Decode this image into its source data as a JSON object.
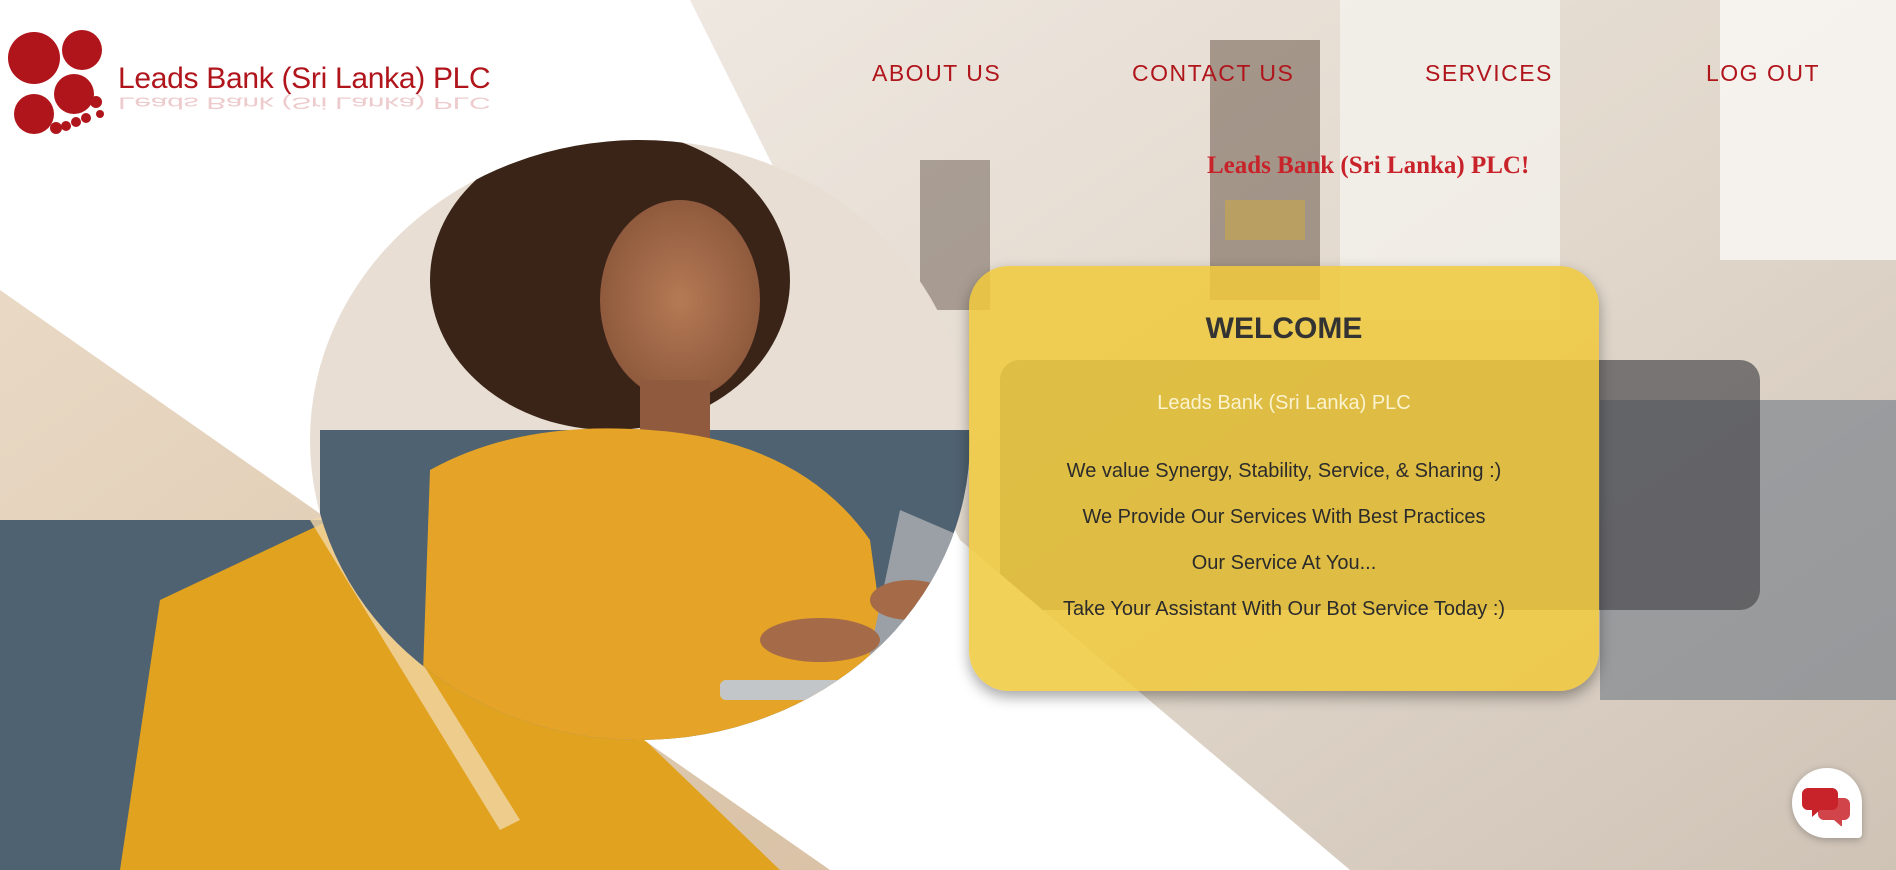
{
  "brand": {
    "name": "Leads Bank (Sri Lanka) PLC",
    "logo_icon": "red-circles-logo-icon",
    "color": "#b0151c"
  },
  "nav": {
    "items": [
      {
        "label": "ABOUT US"
      },
      {
        "label": "CONTACT US"
      },
      {
        "label": "SERVICES"
      },
      {
        "label": "LOG OUT"
      }
    ]
  },
  "greeting": "Leads Bank (Sri Lanka) PLC!",
  "welcome": {
    "title": "WELCOME",
    "subtitle": "Leads Bank (Sri Lanka) PLC",
    "lines": [
      "We value Synergy, Stability, Service, & Sharing :)",
      "We Provide Our Services With Best Practices",
      "Our Service At You...",
      "Take Your Assistant With Our Bot Service Today :)"
    ],
    "card_color": "#f0ca3c"
  },
  "chat": {
    "icon": "chat-bubbles-icon",
    "color": "#c8232a"
  }
}
